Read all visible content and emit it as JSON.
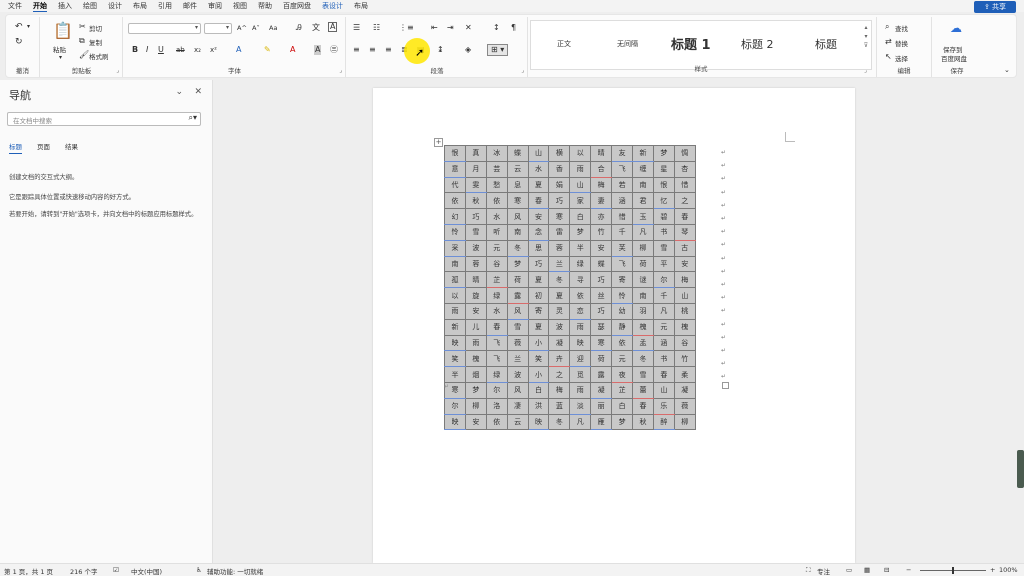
{
  "menu": {
    "tabs": [
      "文件",
      "开始",
      "插入",
      "绘图",
      "设计",
      "布局",
      "引用",
      "邮件",
      "审阅",
      "视图",
      "帮助",
      "百度网盘",
      "表设计",
      "布局"
    ],
    "active": "开始",
    "share_label": "共享"
  },
  "ribbon": {
    "undo": {
      "label": "撤消"
    },
    "clipboard": {
      "label": "剪贴板",
      "paste": "粘贴",
      "cut": "剪切",
      "copy": "复制",
      "format_painter": "格式刷"
    },
    "font": {
      "label": "字体",
      "grow": "A^",
      "shrink": "A˅",
      "case": "Aa"
    },
    "paragraph": {
      "label": "段落"
    },
    "styles": {
      "label": "样式",
      "items": [
        "正文",
        "无间隔",
        "标题 1",
        "标题 2",
        "标题"
      ]
    },
    "editing": {
      "label": "编辑",
      "find": "查找",
      "replace": "替换",
      "select": "选择"
    },
    "save": {
      "label": "保存",
      "save_to_baidu": "保存到",
      "baidu_disk": "百度网盘"
    }
  },
  "nav": {
    "title": "导航",
    "search_placeholder": "在文档中搜索",
    "tabs": [
      "标题",
      "页面",
      "结果"
    ],
    "active_tab": "标题",
    "text1": "创建文档的交互式大纲。",
    "text2": "它是跟踪具体位置或快速移动内容的好方式。",
    "text3": "若要开始，请转到\"开始\"选项卡，并向文档中的标题应用标题样式。"
  },
  "table": {
    "rows": [
      [
        "恨",
        "真",
        "冰",
        "蝶",
        "山",
        "横",
        "以",
        "晴",
        "友",
        "新",
        "梦",
        "惆"
      ],
      [
        "意",
        "月",
        "芸",
        "云",
        "水",
        "香",
        "雨",
        "合",
        "飞",
        "缠",
        "星",
        "杏"
      ],
      [
        "代",
        "雯",
        "愁",
        "息",
        "夏",
        "娟",
        "山",
        "梅",
        "若",
        "南",
        "恨",
        "惜"
      ],
      [
        "依",
        "秋",
        "依",
        "寒",
        "春",
        "巧",
        "家",
        "妻",
        "涵",
        "君",
        "忆",
        "之"
      ],
      [
        "幻",
        "巧",
        "水",
        "风",
        "安",
        "寒",
        "白",
        "亦",
        "惜",
        "玉",
        "碧",
        "春"
      ],
      [
        "怜",
        "雪",
        "听",
        "南",
        "念",
        "雷",
        "梦",
        "竹",
        "千",
        "凡",
        "书",
        "琴"
      ],
      [
        "采",
        "波",
        "元",
        "冬",
        "思",
        "蓉",
        "半",
        "安",
        "芙",
        "柳",
        "雪",
        "古"
      ],
      [
        "南",
        "蓉",
        "谷",
        "梦",
        "巧",
        "兰",
        "绿",
        "蝶",
        "飞",
        "荷",
        "平",
        "安"
      ],
      [
        "孤",
        "晴",
        "芷",
        "荷",
        "夏",
        "冬",
        "寻",
        "巧",
        "寄",
        "谜",
        "尔",
        "梅"
      ],
      [
        "以",
        "旋",
        "绿",
        "露",
        "初",
        "夏",
        "依",
        "丝",
        "怜",
        "南",
        "千",
        "山"
      ],
      [
        "雨",
        "安",
        "水",
        "风",
        "寄",
        "灵",
        "恋",
        "巧",
        "幼",
        "羽",
        "凡",
        "桃"
      ],
      [
        "新",
        "儿",
        "春",
        "雪",
        "夏",
        "波",
        "雨",
        "瑟",
        "静",
        "槐",
        "元",
        "槐"
      ],
      [
        "映",
        "雨",
        "飞",
        "薇",
        "小",
        "凝",
        "映",
        "寒",
        "依",
        "孟",
        "涵",
        "谷"
      ],
      [
        "笑",
        "槐",
        "飞",
        "兰",
        "笑",
        "卉",
        "迎",
        "荷",
        "元",
        "冬",
        "书",
        "竹"
      ],
      [
        "半",
        "烟",
        "绿",
        "波",
        "小",
        "之",
        "觅",
        "露",
        "夜",
        "雪",
        "春",
        "柔"
      ],
      [
        "寒",
        "梦",
        "尔",
        "风",
        "白",
        "梅",
        "雨",
        "凝",
        "芷",
        "蕾",
        "山",
        "凝"
      ],
      [
        "尔",
        "柳",
        "洛",
        "凄",
        "洪",
        "蓝",
        "淡",
        "丽",
        "白",
        "春",
        "乐",
        "薇"
      ],
      [
        "映",
        "安",
        "依",
        "云",
        "映",
        "冬",
        "凡",
        "雁",
        "梦",
        "秋",
        "醉",
        "柳"
      ]
    ]
  },
  "status": {
    "pages": "第 1 页，共 1 页",
    "words": "216 个字",
    "language": "中文(中国)",
    "accessibility": "辅助功能: 一切就绪",
    "focus": "专注",
    "zoom": "100%"
  },
  "colors": {
    "accent": "#1f5fb8",
    "table_bg": "#c8c8c8",
    "underline_blue": "#6d8fd6",
    "underline_red": "#d86b6b",
    "cursor_highlight": "#ffe600"
  }
}
